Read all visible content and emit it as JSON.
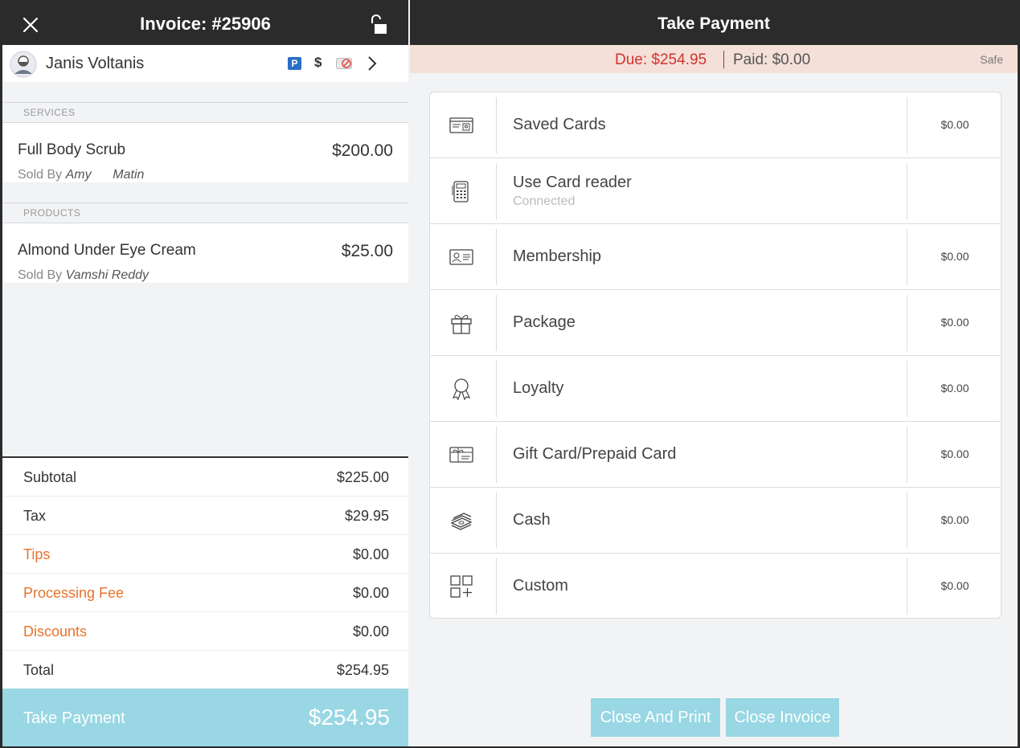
{
  "invoice": {
    "title": "Invoice: #25906",
    "client_name": "Janis Voltanis",
    "badge_p": "P",
    "badge_dollar": "$",
    "sections": {
      "services_label": "SERVICES",
      "products_label": "PRODUCTS"
    },
    "services": [
      {
        "name": "Full Body Scrub",
        "price": "$200.00",
        "sold_by_label": "Sold By",
        "sold_by": "Amy      Matin"
      }
    ],
    "products": [
      {
        "name": "Almond Under Eye Cream",
        "price": "$25.00",
        "sold_by_label": "Sold By",
        "sold_by": "Vamshi Reddy"
      }
    ],
    "totals": [
      {
        "label": "Subtotal",
        "value": "$225.00"
      },
      {
        "label": "Tax",
        "value": "$29.95"
      },
      {
        "label": "Tips",
        "value": "$0.00"
      },
      {
        "label": "Processing Fee",
        "value": "$0.00"
      },
      {
        "label": "Discounts",
        "value": "$0.00"
      },
      {
        "label": "Total",
        "value": "$254.95"
      }
    ],
    "take_payment_label": "Take Payment",
    "take_payment_amount": "$254.95"
  },
  "payment": {
    "title": "Take Payment",
    "due": "Due: $254.95",
    "paid": "Paid: $0.00",
    "safe_label": "Safe",
    "methods": [
      {
        "name": "Saved Cards",
        "amount": "$0.00",
        "icon": "saved-card-icon"
      },
      {
        "name": "Use Card reader",
        "sub": "Connected",
        "amount": "",
        "icon": "card-reader-icon"
      },
      {
        "name": "Membership",
        "amount": "$0.00",
        "icon": "membership-card-icon"
      },
      {
        "name": "Package",
        "amount": "$0.00",
        "icon": "gift-box-icon"
      },
      {
        "name": "Loyalty",
        "amount": "$0.00",
        "icon": "award-ribbon-icon"
      },
      {
        "name": "Gift Card/Prepaid Card",
        "amount": "$0.00",
        "icon": "gift-card-icon"
      },
      {
        "name": "Cash",
        "amount": "$0.00",
        "icon": "cash-stack-icon"
      },
      {
        "name": "Custom",
        "amount": "$0.00",
        "icon": "custom-grid-icon"
      }
    ],
    "close_and_print_label": "Close And Print",
    "close_invoice_label": "Close Invoice"
  },
  "colors": {
    "accent": "#98d7e3",
    "due_red": "#d0342c",
    "orange": "#e8722c",
    "header_dark": "#2b2b2b"
  }
}
